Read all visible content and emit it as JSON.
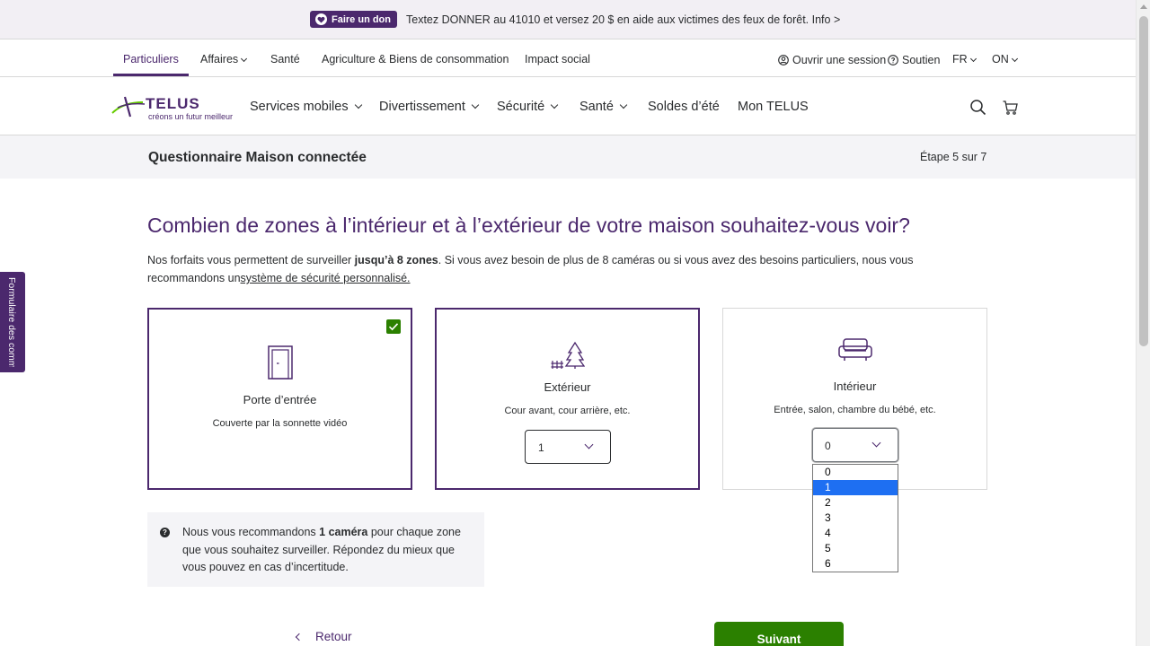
{
  "announcement": {
    "donate_label": "Faire un don",
    "text": "Textez DONNER au 41010 et versez 20 $ en aide aux victimes des feux de forêt. Info >"
  },
  "utility_nav": {
    "items": [
      "Particuliers",
      "Affaires",
      "Santé",
      "Agriculture & Biens de consommation",
      "Impact social"
    ],
    "sign_in": "Ouvrir une session",
    "support": "Soutien",
    "language": "FR",
    "province": "ON"
  },
  "logo": {
    "name": "TELUS",
    "tagline": "créons un futur meilleur"
  },
  "main_nav": {
    "items": [
      "Services mobiles",
      "Divertissement",
      "Sécurité",
      "Santé",
      "Soldes d’été",
      "Mon TELUS"
    ]
  },
  "questionnaire": {
    "title": "Questionnaire Maison connectée",
    "step": "Étape 5 sur 7"
  },
  "content": {
    "headline": "Combien de zones à l’intérieur et à l’extérieur de votre maison souhaitez-vous voir?",
    "intro_before": "Nos forfaits vous permettent de surveiller ",
    "intro_bold": "jusqu’à 8 zones",
    "intro_middle": ". Si vous avez besoin de plus de 8 caméras ou si vous avez des besoins particuliers, nous vous recommandons un",
    "intro_link": "système de sécurité personnalisé."
  },
  "cards": [
    {
      "title": "Porte d’entrée",
      "subtitle": "Couverte par la sonnette vidéo",
      "icon": "door-icon",
      "selected": true
    },
    {
      "title": "Extérieur",
      "subtitle": "Cour avant, cour arrière, etc.",
      "icon": "trees-icon",
      "selected": true,
      "value": "1"
    },
    {
      "title": "Intérieur",
      "subtitle": "Entrée, salon, chambre du bébé, etc.",
      "icon": "sofa-icon",
      "selected": false,
      "value": "0"
    }
  ],
  "dropdown": {
    "options": [
      "0",
      "1",
      "2",
      "3",
      "4",
      "5",
      "6"
    ],
    "highlighted": "1"
  },
  "info": {
    "before": "Nous vous recommandons ",
    "bold": "1 caméra",
    "after": " pour chaque zone que vous souhaitez surveiller. Répondez du mieux que vous pouvez en cas d’incertitude."
  },
  "actions": {
    "back": "Retour",
    "next": "Suivant"
  },
  "feedback_tab": "Formulaire des commentaires",
  "colors": {
    "brand_purple": "#4b286d",
    "brand_green": "#2b8000",
    "highlight_blue": "#1e6ff2"
  }
}
